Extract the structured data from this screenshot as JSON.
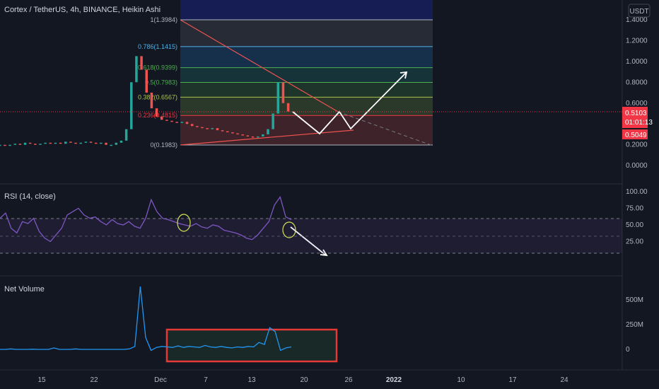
{
  "header": {
    "title": "Cortex / TetherUS, 4h, BINANCE, Heikin Ashi",
    "currency_badge": "USDT"
  },
  "x_axis": {
    "labels": [
      "15",
      "22",
      "Dec",
      "7",
      "13",
      "20",
      "26",
      "2022",
      "10",
      "17",
      "24"
    ]
  },
  "price_pane": {
    "ticks": [
      "1.4000",
      "1.2000",
      "1.0000",
      "0.8000",
      "0.6000",
      "0.4000",
      "0.2000",
      "0.0000"
    ],
    "current_price": "0.5103",
    "countdown": "01:01:13",
    "last_close": "0.5049",
    "fib_levels": [
      {
        "label": "1(1.3984)",
        "color": "#b2b5be"
      },
      {
        "label": "0.786(1.1415)",
        "color": "#4fb3e8"
      },
      {
        "label": "0.618(0.9399)",
        "color": "#4caf50"
      },
      {
        "label": "0.5(0.7983)",
        "color": "#4caf50"
      },
      {
        "label": "0.382(0.6567)",
        "color": "#a8c44a"
      },
      {
        "label": "0.236(0.4815)",
        "color": "#f23645"
      },
      {
        "label": "0(0.1983)",
        "color": "#b2b5be"
      }
    ]
  },
  "rsi_pane": {
    "title": "RSI (14, close)",
    "ticks": [
      "100.00",
      "75.00",
      "50.00",
      "25.00"
    ]
  },
  "volume_pane": {
    "title": "Net Volume",
    "ticks": [
      "500M",
      "250M",
      "0"
    ]
  },
  "chart_data": [
    {
      "type": "candlestick",
      "title": "Cortex / TetherUS, 4h, BINANCE, Heikin Ashi",
      "ylim": [
        0,
        1.45
      ],
      "fib_retracement": [
        {
          "ratio": 1,
          "price": 1.3984
        },
        {
          "ratio": 0.786,
          "price": 1.1415
        },
        {
          "ratio": 0.618,
          "price": 0.9399
        },
        {
          "ratio": 0.5,
          "price": 0.7983
        },
        {
          "ratio": 0.382,
          "price": 0.6567
        },
        {
          "ratio": 0.236,
          "price": 0.4815
        },
        {
          "ratio": 0,
          "price": 0.1983
        }
      ],
      "series": [
        {
          "values": [
            0.2,
            0.19,
            0.2,
            0.21,
            0.2,
            0.22,
            0.21,
            0.2,
            0.21,
            0.22,
            0.21,
            0.22,
            0.21,
            0.23,
            0.22,
            0.21,
            0.22,
            0.23,
            0.22,
            0.21,
            0.22,
            0.2,
            0.2,
            0.22,
            0.24,
            0.35,
            0.8,
            1.05,
            0.92,
            0.7,
            0.55,
            0.47,
            0.44,
            0.43,
            0.42,
            0.41,
            0.42,
            0.4,
            0.38,
            0.37,
            0.36,
            0.35,
            0.36,
            0.34,
            0.33,
            0.32,
            0.31,
            0.3,
            0.29,
            0.28,
            0.27,
            0.28,
            0.3,
            0.35,
            0.5,
            0.8,
            0.6,
            0.52,
            0.51
          ]
        }
      ]
    },
    {
      "type": "line",
      "title": "RSI (14, close)",
      "ylim": [
        0,
        100
      ],
      "series": [
        {
          "values": [
            60,
            68,
            45,
            38,
            55,
            52,
            60,
            40,
            30,
            25,
            35,
            45,
            65,
            70,
            75,
            65,
            60,
            62,
            55,
            50,
            58,
            52,
            50,
            55,
            48,
            45,
            60,
            88,
            70,
            60,
            58,
            55,
            52,
            50,
            48,
            52,
            47,
            45,
            50,
            48,
            42,
            40,
            38,
            35,
            30,
            28,
            35,
            45,
            55,
            80,
            92,
            62,
            58
          ]
        }
      ]
    },
    {
      "type": "line",
      "title": "Net Volume",
      "ylim": [
        -50,
        650
      ],
      "series": [
        {
          "values": [
            0,
            0,
            5,
            0,
            0,
            0,
            2,
            0,
            0,
            0,
            15,
            0,
            0,
            0,
            5,
            0,
            0,
            0,
            0,
            0,
            0,
            0,
            0,
            0,
            5,
            30,
            650,
            120,
            -10,
            20,
            30,
            25,
            20,
            35,
            20,
            30,
            25,
            20,
            40,
            25,
            20,
            30,
            20,
            15,
            25,
            20,
            30,
            25,
            70,
            50,
            220,
            180,
            -10,
            15,
            25
          ]
        }
      ]
    }
  ]
}
